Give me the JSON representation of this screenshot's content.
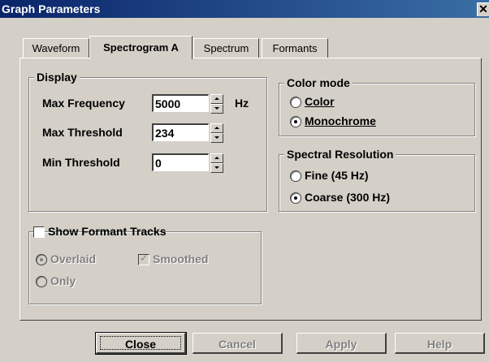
{
  "window": {
    "title": "Graph Parameters",
    "close_glyph": "✕"
  },
  "tabs": [
    {
      "label": "Waveform",
      "active": false
    },
    {
      "label": "Spectrogram A",
      "active": true
    },
    {
      "label": "Spectrum",
      "active": false
    },
    {
      "label": "Formants",
      "active": false
    }
  ],
  "display": {
    "label": "Display",
    "max_frequency": {
      "label": "Max Frequency",
      "value": "5000",
      "unit": "Hz"
    },
    "max_threshold": {
      "label": "Max Threshold",
      "value": "234"
    },
    "min_threshold": {
      "label": "Min Threshold",
      "value": "0"
    }
  },
  "color_mode": {
    "label": "Color mode",
    "options": [
      {
        "label": "Color",
        "selected": false
      },
      {
        "label": "Monochrome",
        "selected": true
      }
    ]
  },
  "spectral_resolution": {
    "label": "Spectral Resolution",
    "options": [
      {
        "label": "Fine (45 Hz)",
        "selected": false
      },
      {
        "label": "Coarse (300 Hz)",
        "selected": true
      }
    ]
  },
  "formant_tracks": {
    "label": "Show Formant Tracks",
    "checked": false,
    "overlaid_label": "Overlaid",
    "only_label": "Only",
    "smoothed_label": "Smoothed",
    "smoothed_checked": true
  },
  "buttons": {
    "close": "Close",
    "cancel": "Cancel",
    "apply": "Apply",
    "help": "Help"
  },
  "colors": {
    "titlebar": "#0a246a",
    "face": "#d4d0c8",
    "disabled_text": "#808080"
  }
}
